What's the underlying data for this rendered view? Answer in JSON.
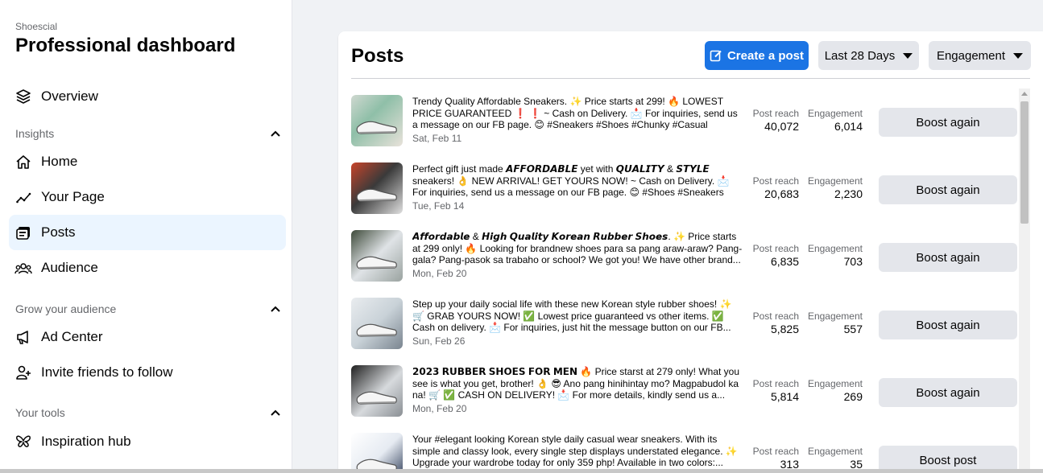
{
  "sidebar": {
    "page_name": "Shoescial",
    "title": "Professional dashboard",
    "overview": "Overview",
    "sections": [
      {
        "label": "Insights",
        "items": [
          "Home",
          "Your Page",
          "Posts",
          "Audience"
        ]
      },
      {
        "label": "Grow your audience",
        "items": [
          "Ad Center",
          "Invite friends to follow"
        ]
      },
      {
        "label": "Your tools",
        "items": [
          "Inspiration hub"
        ]
      }
    ],
    "active_item": "Posts"
  },
  "main": {
    "title": "Posts",
    "create_post": "Create a post",
    "date_range": "Last 28 Days",
    "sort_by": "Engagement",
    "reach_label": "Post reach",
    "engagement_label": "Engagement",
    "posts": [
      {
        "text": "Trendy Quality Affordable Sneakers. ✨ Price starts at 299! 🔥 LOWEST PRICE GUARANTEED ❗ ❗ ~ Cash on Delivery. 📩 For inquiries, send us a message on our FB page. 😊 #Sneakers #Shoes #Chunky #Casual #Sports...",
        "date": "Sat, Feb 11",
        "reach": "40,072",
        "engagement": "6,014",
        "action": "Boost again"
      },
      {
        "text": "Perfect gift just made 𝘼𝙁𝙁𝙊𝙍𝘿𝘼𝘽𝙇𝙀 yet with 𝙌𝙐𝘼𝙇𝙄𝙏𝙔 & 𝙎𝙏𝙔𝙇𝙀 sneakers! 👌 NEW ARRIVAL! GET YOURS NOW! ~ Cash on Delivery. 📩 For inquiries, send us a message on our FB page. 😊 #Shoes #Sneakers #Casu...",
        "date": "Tue, Feb 14",
        "reach": "20,683",
        "engagement": "2,230",
        "action": "Boost again"
      },
      {
        "text": "𝘼𝙛𝙛𝙤𝙧𝙙𝙖𝙗𝙡𝙚 & 𝙃𝙞𝙜𝙝 𝙌𝙪𝙖𝙡𝙞𝙩𝙮 𝙆𝙤𝙧𝙚𝙖𝙣 𝙍𝙪𝙗𝙗𝙚𝙧 𝙎𝙝𝙤𝙚𝙨. ✨ Price starts at 299 only! 🔥 Looking for brandnew shoes para sa pang araw-araw? Pang-gala? Pang-pasok sa trabaho or school? We got you! We have other brand...",
        "date": "Mon, Feb 20",
        "reach": "6,835",
        "engagement": "703",
        "action": "Boost again"
      },
      {
        "text": "Step up your daily social life with these new Korean style rubber shoes! ✨ 🛒 GRAB YOURS NOW! ✅ Lowest price guaranteed vs other items. ✅ Cash on delivery. 📩 For inquiries, just hit the message button on our FB...",
        "date": "Sun, Feb 26",
        "reach": "5,825",
        "engagement": "557",
        "action": "Boost again"
      },
      {
        "text": "𝟮𝟬𝟮𝟯 𝗥𝗨𝗕𝗕𝗘𝗥 𝗦𝗛𝗢𝗘𝗦 𝗙𝗢𝗥 𝗠𝗘𝗡 🔥 Price starst at 279 only! What you see is what you get, brother! 👌 😎 Ano pang hinihintay mo? Magpabudol ka na! 🛒 ✅ CASH ON DELIVERY! 📩 For more details, kindly send us a...",
        "date": "Mon, Feb 20",
        "reach": "5,814",
        "engagement": "269",
        "action": "Boost again"
      },
      {
        "text": "Your #elegant looking Korean style daily casual wear sneakers. With its simple and classy look, every single step displays understated elegance. ✨ Upgrade your wardrobe today for only 359 php! Available in two colors:...",
        "date": "",
        "reach": "313",
        "engagement": "35",
        "action": "Boost post"
      }
    ]
  },
  "colors": {
    "primary": "#1b74e4",
    "active_nav_bg": "#ebf5ff",
    "button_gray": "#e4e6eb",
    "secondary_text": "#65676b"
  }
}
